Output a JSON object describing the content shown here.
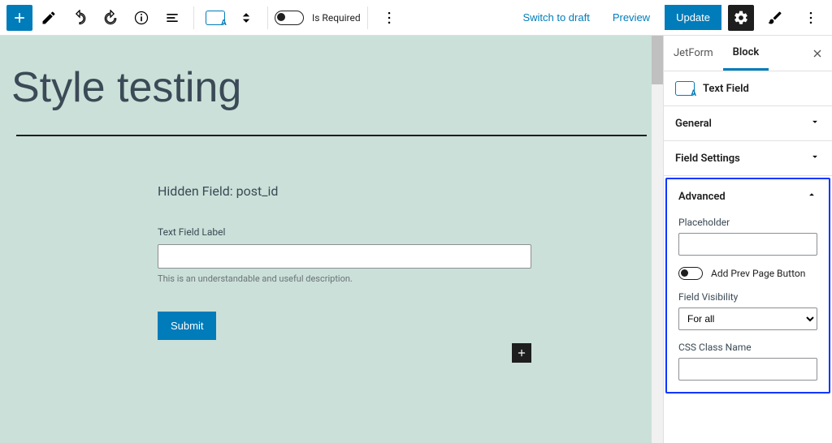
{
  "topbar": {
    "is_required_label": "Is Required",
    "switch_draft": "Switch to draft",
    "preview": "Preview",
    "update": "Update"
  },
  "canvas": {
    "title": "Style testing",
    "hidden_field": "Hidden Field: post_id",
    "text_field_label": "Text Field Label",
    "description": "This is an understandable and useful description.",
    "submit": "Submit"
  },
  "sidebar": {
    "tabs": {
      "jetform": "JetForm",
      "block": "Block"
    },
    "block_name": "Text Field",
    "panels": {
      "general": "General",
      "field_settings": "Field Settings",
      "advanced": "Advanced"
    },
    "advanced": {
      "placeholder_label": "Placeholder",
      "placeholder_value": "",
      "add_prev": "Add Prev Page Button",
      "visibility_label": "Field Visibility",
      "visibility_value": "For all",
      "css_class_label": "CSS Class Name",
      "css_class_value": ""
    }
  }
}
